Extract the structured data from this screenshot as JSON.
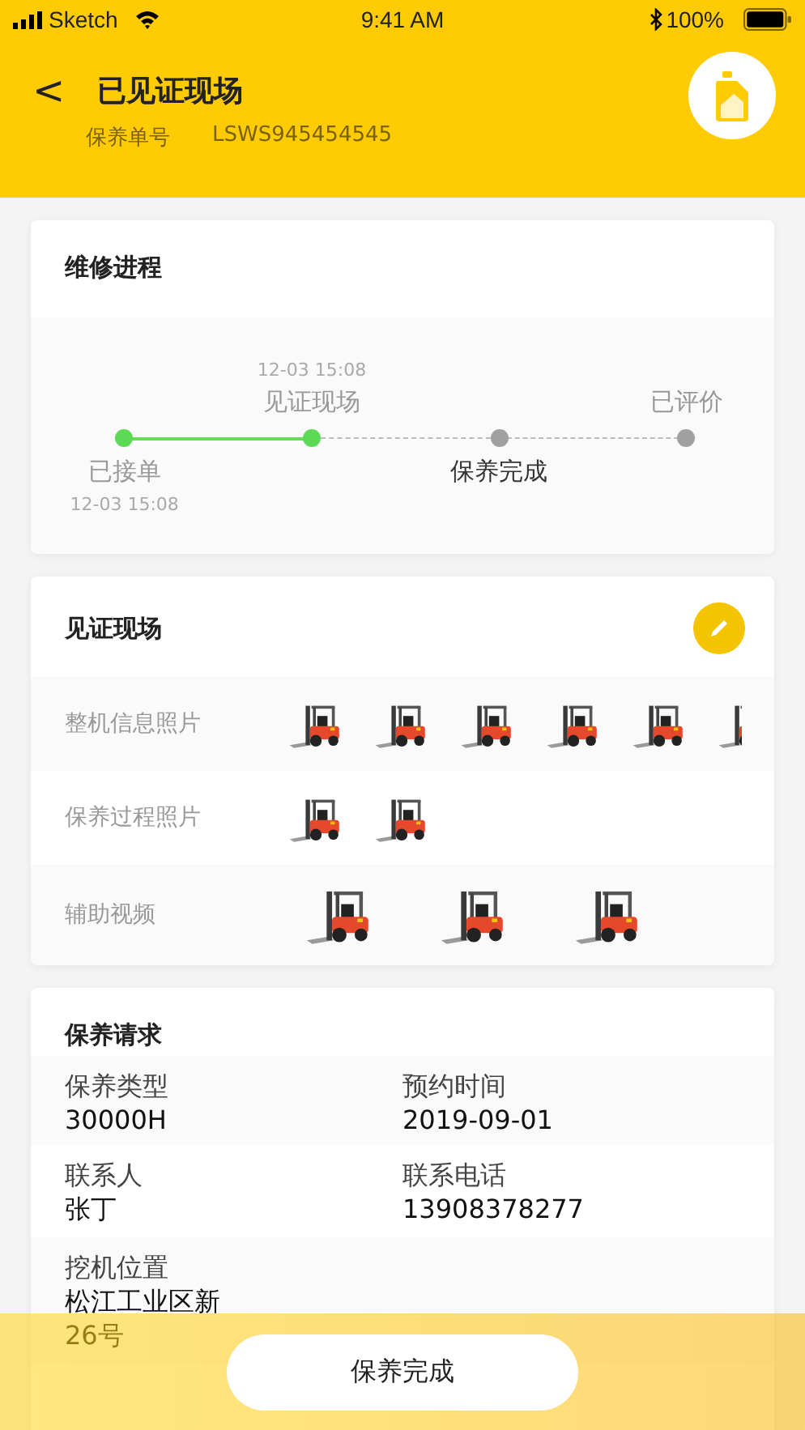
{
  "status_bar": {
    "carrier": "Sketch",
    "time": "9:41 AM",
    "battery": "100%"
  },
  "header": {
    "back": "<",
    "title": "已见证现场",
    "order_label": "保养单号",
    "order_no": "LSWS945454545"
  },
  "progress": {
    "title": "维修进程",
    "steps": [
      {
        "label": "已接单",
        "time": "12-03 15:08",
        "done": true,
        "current": false
      },
      {
        "label": "见证现场",
        "time": "12-03 15:08",
        "done": true,
        "current": false
      },
      {
        "label": "保养完成",
        "done": false,
        "current": true
      },
      {
        "label": "已评价",
        "done": false,
        "current": false
      }
    ]
  },
  "witness": {
    "title": "见证现场",
    "rows": [
      {
        "label": "整机信息照片",
        "kind": "photos"
      },
      {
        "label": "保养过程照片",
        "kind": "photos"
      },
      {
        "label": "辅助视频",
        "kind": "videos"
      }
    ]
  },
  "request": {
    "title": "保养请求",
    "fields": [
      {
        "label": "保养类型",
        "value": "30000H"
      },
      {
        "label": "预约时间",
        "value": "2019-09-01"
      },
      {
        "label": "联系人",
        "value": "张丁"
      },
      {
        "label": "联系电话",
        "value": "13908378277"
      },
      {
        "label": "挖机位置",
        "value": "松江工业区新",
        "value_end": "26号"
      }
    ]
  },
  "bottom_button": "保养完成"
}
